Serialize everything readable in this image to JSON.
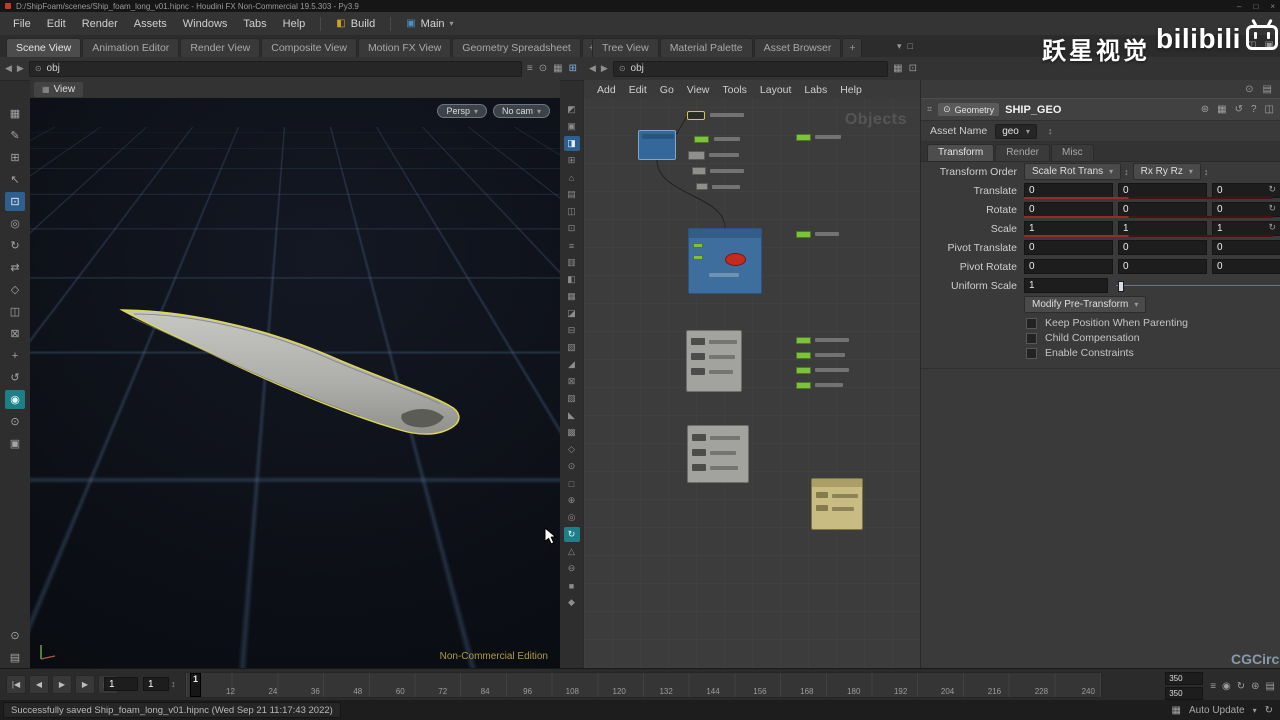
{
  "window": {
    "title": "D:/ShipFoam/scenes/Ship_foam_long_v01.hipnc - Houdini FX Non-Commercial 19.5.303 - Py3.9",
    "controls": [
      "–",
      "□",
      "×"
    ]
  },
  "menubar": {
    "menus": [
      "File",
      "Edit",
      "Render",
      "Assets",
      "Windows",
      "Tabs",
      "Help"
    ],
    "build": "Build",
    "main": "Main"
  },
  "left_pane": {
    "tabs": [
      "Scene View",
      "Animation Editor",
      "Render View",
      "Composite View",
      "Motion FX View",
      "Geometry Spreadsheet"
    ],
    "new_tab": "+",
    "path": "obj",
    "view_tab": "View",
    "persp": "Persp",
    "camera": "No cam",
    "edition": "Non-Commercial Edition"
  },
  "network_pane": {
    "tabs": [
      "Tree View",
      "Material Palette",
      "Asset Browser"
    ],
    "new_tab": "+",
    "path": "obj",
    "menus": [
      "Add",
      "Edit",
      "Go",
      "View",
      "Tools",
      "Layout",
      "Labs",
      "Help"
    ],
    "watermark": "Objects"
  },
  "params": {
    "context": "Geometry",
    "node_name": "SHIP_GEO",
    "asset_name_label": "Asset Name",
    "asset_name": "geo",
    "tabs": [
      "Transform",
      "Render",
      "Misc"
    ],
    "transform_order": {
      "label": "Transform Order",
      "order": "Scale Rot Trans",
      "rotate_order": "Rx Ry Rz"
    },
    "vector_rows": [
      {
        "label": "Translate",
        "values": [
          "0",
          "0",
          "0"
        ],
        "slider": true
      },
      {
        "label": "Rotate",
        "values": [
          "0",
          "0",
          "0"
        ],
        "slider": true
      },
      {
        "label": "Scale",
        "values": [
          "1",
          "1",
          "1"
        ],
        "slider": true
      },
      {
        "label": "Pivot Translate",
        "values": [
          "0",
          "0",
          "0"
        ],
        "slider": false
      },
      {
        "label": "Pivot Rotate",
        "values": [
          "0",
          "0",
          "0"
        ],
        "slider": false
      }
    ],
    "uniform_scale": {
      "label": "Uniform Scale",
      "value": "1"
    },
    "modify_pretransform": "Modify Pre-Transform",
    "checkboxes": [
      {
        "label": "Keep Position When Parenting",
        "checked": false
      },
      {
        "label": "Child Compensation",
        "checked": false
      },
      {
        "label": "Enable Constraints",
        "checked": false
      }
    ]
  },
  "left_toolbar": {
    "glyphs": [
      "▦",
      "✎",
      "⊞",
      "↖",
      "⊡",
      "◎",
      "↻",
      "⇄",
      "◇",
      "◫",
      "⊠",
      "+",
      "↺",
      "◉",
      "⊙",
      "▣"
    ],
    "blue_index": 4,
    "teal_index": 13
  },
  "viewport_options": {
    "glyphs": [
      "◩",
      "▣",
      "◨",
      "⊞",
      "⌂",
      "▤",
      "◫",
      "⊡",
      "≡",
      "▥",
      "◧",
      "▦",
      "◪",
      "⊟",
      "▧",
      "◢",
      "⊠",
      "▨",
      "◣",
      "▩",
      "◇",
      "⊙",
      "□",
      "⊕",
      "◎",
      "↻",
      "△",
      "⊖",
      "■",
      "◆"
    ],
    "blue_index": 2,
    "teal_index": 25
  },
  "timeline": {
    "transport": [
      {
        "name": "jump-start",
        "glyph": "|◀"
      },
      {
        "name": "step-back",
        "glyph": "◀"
      },
      {
        "name": "play",
        "glyph": "▶"
      },
      {
        "name": "step-forward",
        "glyph": "▶"
      },
      {
        "name": "jump-end",
        "glyph": "▶|"
      }
    ],
    "current_frame": "1",
    "frame_stepper": "1",
    "playhead_label": "1",
    "ticks": [
      "12",
      "24",
      "36",
      "48",
      "60",
      "72",
      "84",
      "96",
      "108",
      "120",
      "132",
      "144",
      "156",
      "168",
      "180",
      "192",
      "204",
      "216",
      "228",
      "240"
    ],
    "range_fields": [
      "350",
      "350"
    ],
    "option_icons": [
      "≡",
      "◉",
      "↻",
      "⊛",
      "▤"
    ]
  },
  "status_bar": {
    "message": "Successfully saved Ship_foam_long_v01.hipnc (Wed Sep 21 11:17:43 2022)",
    "auto_update": "Auto Update"
  },
  "watermarks": {
    "studio": "跃星视觉",
    "platform": "bilibili",
    "course": "CGCircuit"
  },
  "colors": {
    "node_blue": "#3e6e9e",
    "node_green": "#7fc03e",
    "selection_yellow": "#d8d24a",
    "slider_red": "#9a282c",
    "edition_gold": "#b09a45"
  }
}
